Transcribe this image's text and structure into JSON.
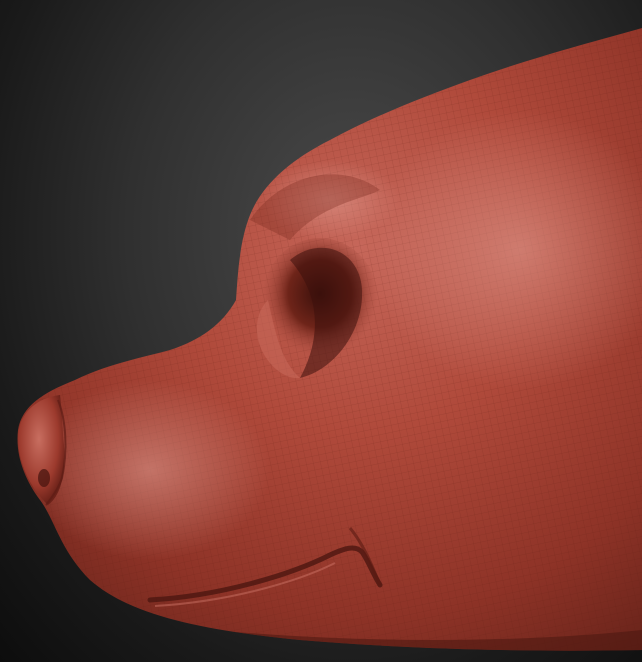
{
  "scene": {
    "subject": "",
    "background_color": "#2e2e2e",
    "material_color": "#b5483a"
  }
}
